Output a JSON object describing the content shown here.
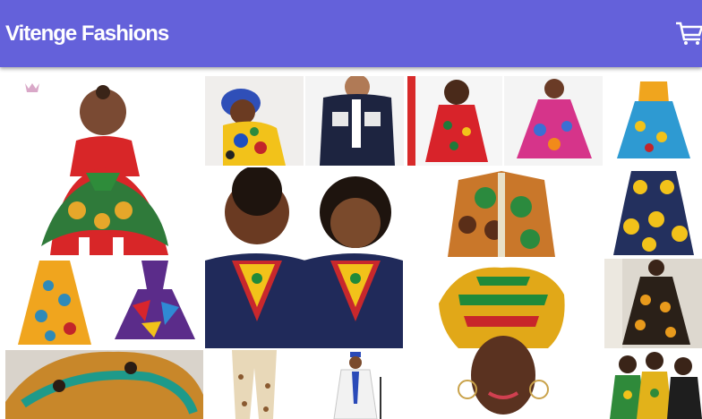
{
  "header": {
    "brand": "Vitenge Fashions",
    "cart_icon": "shopping-cart-icon",
    "bg_color": "#6461da"
  },
  "gallery": {
    "items": [
      {
        "id": "toddler-dress",
        "icon": "toddler-ankara-dress"
      },
      {
        "id": "baby-headwrap",
        "icon": "baby-print-romper"
      },
      {
        "id": "boy-navy-shirt",
        "icon": "boy-navy-shirt"
      },
      {
        "id": "girl-red-dress",
        "icon": "girl-red-print-dress"
      },
      {
        "id": "pink-dress",
        "icon": "pink-print-dress"
      },
      {
        "id": "blue-dress",
        "icon": "blue-print-dress"
      },
      {
        "id": "kids-dashiki",
        "icon": "kids-dashiki-shirts"
      },
      {
        "id": "green-print-shirt",
        "icon": "green-print-shirt"
      },
      {
        "id": "navy-yellow-dress",
        "icon": "navy-yellow-dress"
      },
      {
        "id": "maxi-skirt",
        "icon": "print-maxi-skirt"
      },
      {
        "id": "purple-dress",
        "icon": "purple-print-dress"
      },
      {
        "id": "headwrap-woman",
        "icon": "kente-headwrap"
      },
      {
        "id": "girl-dot-dress",
        "icon": "girl-print-dress"
      },
      {
        "id": "bucket-hat",
        "icon": "print-bucket-hat"
      },
      {
        "id": "print-trousers",
        "icon": "print-trousers"
      },
      {
        "id": "white-outfit",
        "icon": "white-kaftan-outfit"
      },
      {
        "id": "group-kids",
        "icon": "kids-group-outfits"
      }
    ]
  }
}
